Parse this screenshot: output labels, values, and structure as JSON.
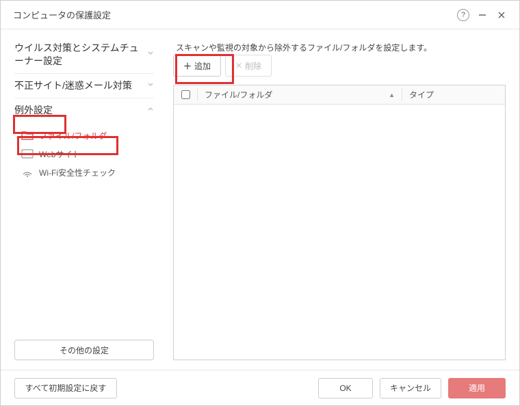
{
  "window": {
    "title": "コンピュータの保護設定"
  },
  "sidebar": {
    "groups": [
      {
        "label": "ウイルス対策とシステムチューナー設定",
        "expanded": false
      },
      {
        "label": "不正サイト/迷惑メール対策",
        "expanded": false
      },
      {
        "label": "例外設定",
        "expanded": true
      }
    ],
    "items": [
      {
        "label": "ファイル/フォルダ",
        "icon": "folder-icon",
        "active": true
      },
      {
        "label": "Webサイト",
        "icon": "www-icon",
        "active": false
      },
      {
        "label": "Wi-Fi安全性チェック",
        "icon": "wifi-icon",
        "active": false
      }
    ],
    "other_settings": "その他の設定"
  },
  "main": {
    "description": "スキャンや監視の対象から除外するファイル/フォルダを設定します。",
    "toolbar": {
      "add_label": "追加",
      "delete_label": "削除"
    },
    "table": {
      "col_file": "ファイル/フォルダ",
      "col_type": "タイプ",
      "rows": []
    }
  },
  "footer": {
    "reset_label": "すべて初期設定に戻す",
    "ok_label": "OK",
    "cancel_label": "キャンセル",
    "apply_label": "適用"
  }
}
